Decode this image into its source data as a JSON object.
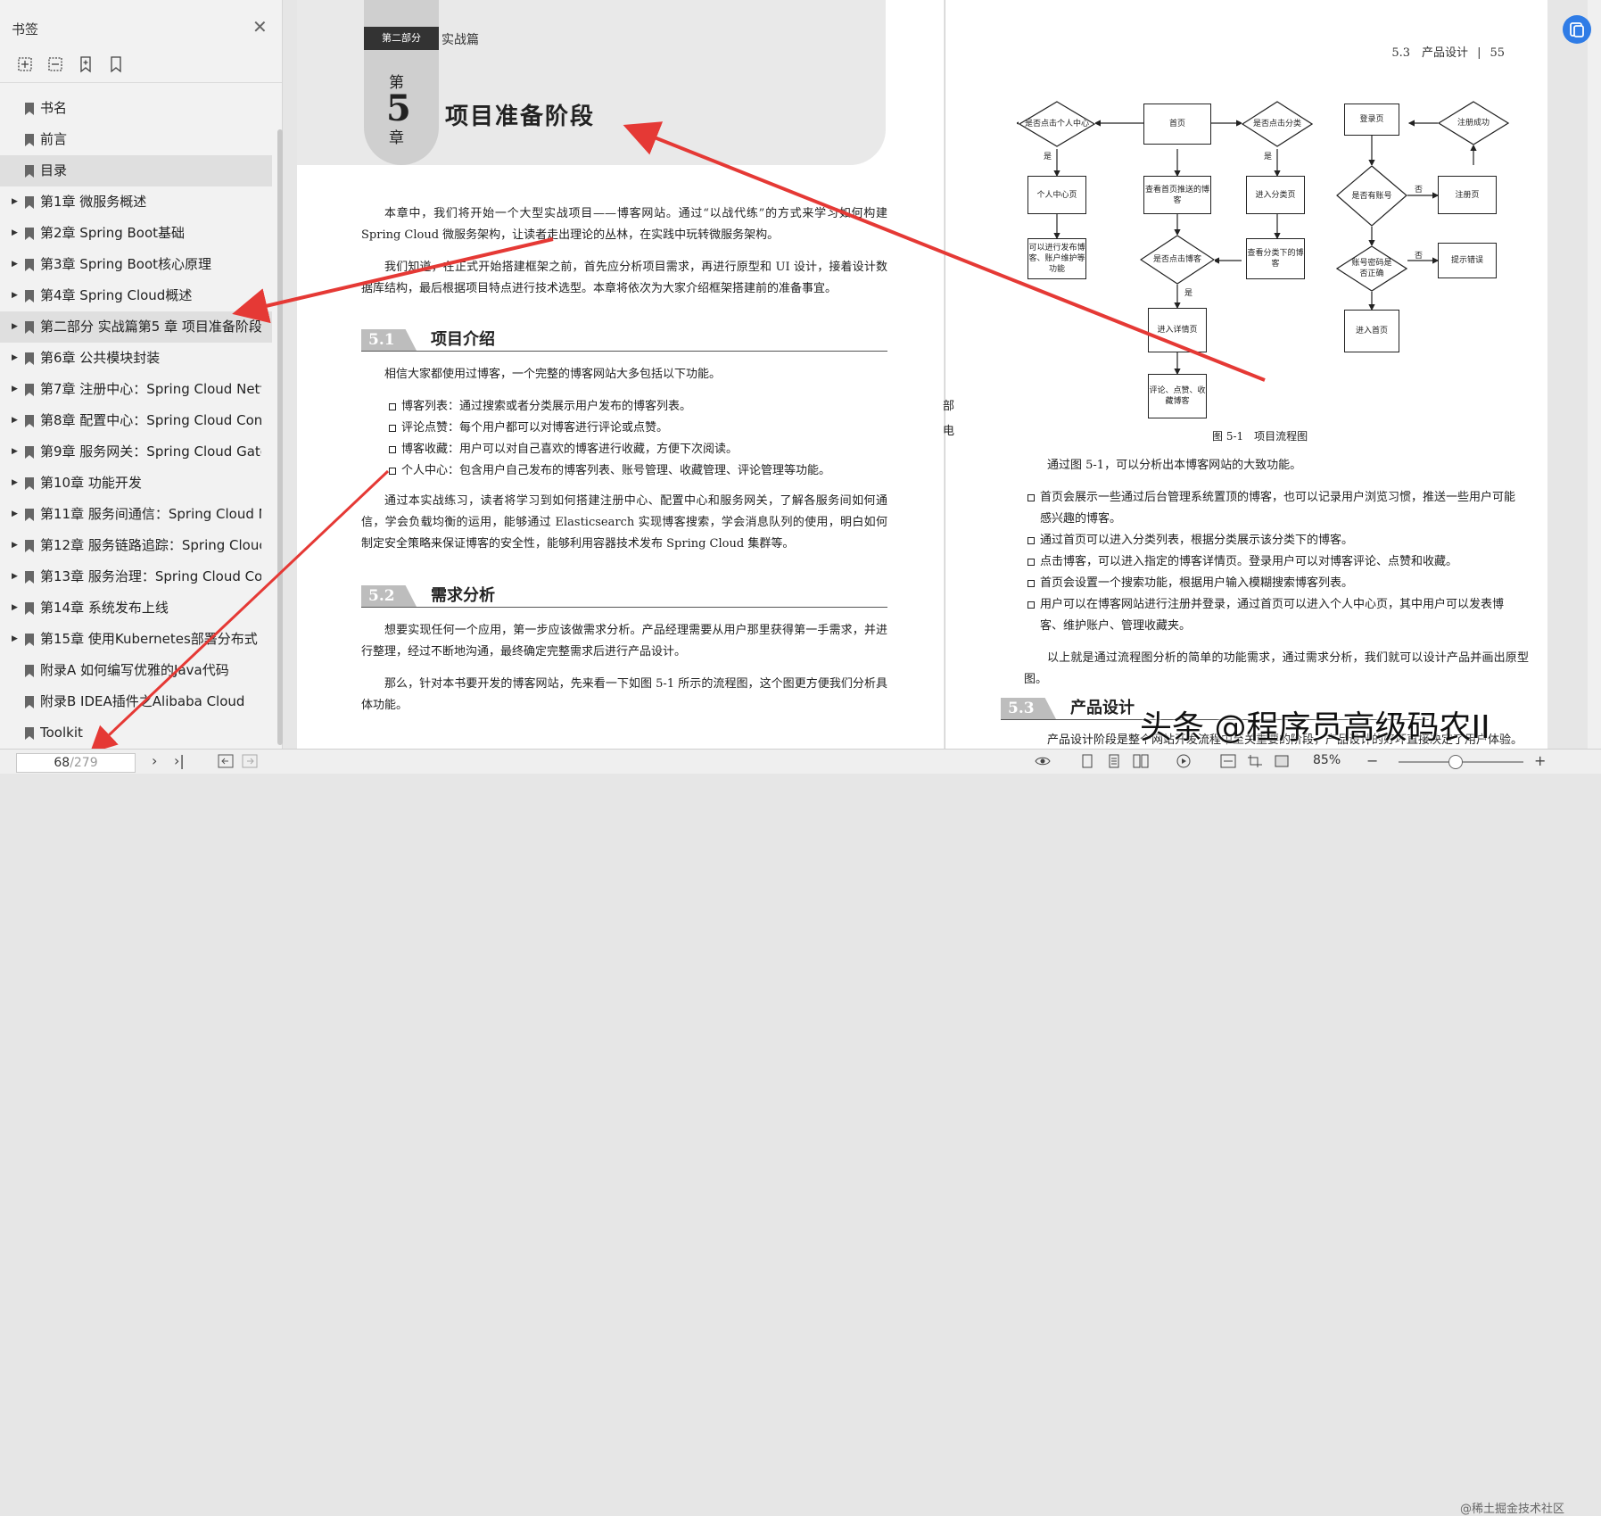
{
  "sidebar": {
    "title": "书签",
    "close_icon": "close-icon",
    "tools": [
      "expand-all-icon",
      "collapse-all-icon",
      "add-bookmark-icon",
      "bookmark-icon"
    ],
    "items": [
      {
        "label": "书名",
        "expandable": false
      },
      {
        "label": "前言",
        "expandable": false
      },
      {
        "label": "目录",
        "expandable": false
      },
      {
        "label": "第1章 微服务概述",
        "expandable": true
      },
      {
        "label": "第2章 Spring Boot基础",
        "expandable": true
      },
      {
        "label": "第3章 Spring Boot核心原理",
        "expandable": true
      },
      {
        "label": "第4章 Spring Cloud概述",
        "expandable": true
      },
      {
        "label": "第二部分 实战篇第5 章 项目准备阶段",
        "expandable": true
      },
      {
        "label": "第6章 公共模块封装",
        "expandable": true
      },
      {
        "label": "第7章 注册中心：Spring Cloud Netf",
        "expandable": true
      },
      {
        "label": "第8章 配置中心：Spring Cloud Con",
        "expandable": true
      },
      {
        "label": "第9章 服务网关：Spring Cloud Gate",
        "expandable": true
      },
      {
        "label": "第10章 功能开发",
        "expandable": true
      },
      {
        "label": "第11章 服务间通信：Spring Cloud N",
        "expandable": true
      },
      {
        "label": "第12章 服务链路追踪：Spring Clouc",
        "expandable": true
      },
      {
        "label": "第13章 服务治理：Spring Cloud Co",
        "expandable": true
      },
      {
        "label": "第14章 系统发布上线",
        "expandable": true
      },
      {
        "label": "第15章 使用Kubernetes部署分布式",
        "expandable": true
      },
      {
        "label": "附录A 如何编写优雅的Java代码",
        "expandable": false
      },
      {
        "label": "附录B IDEA插件之Alibaba Cloud",
        "expandable": false
      },
      {
        "label": "Toolkit",
        "expandable": false
      }
    ]
  },
  "bottom": {
    "page_current": "68",
    "page_total": "/279",
    "zoom": "85%"
  },
  "left_page": {
    "part_label": "第二部分",
    "part_name": "实战篇",
    "chapter_di": "第",
    "chapter_num": "5",
    "chapter_zhang": "章",
    "chapter_title": "项目准备阶段",
    "intro1": "本章中，我们将开始一个大型实战项目——博客网站。通过“以战代练”的方式来学习如何构建Spring Cloud 微服务架构，让读者走出理论的丛林，在实践中玩转微服务架构。",
    "intro2": "我们知道，在正式开始搭建框架之前，首先应分析项目需求，再进行原型和 UI 设计，接着设计数据库结构，最后根据项目特点进行技术选型。本章将依次为大家介绍框架搭建前的准备事宜。",
    "sec1_num": "5.1",
    "sec1_title": "项目介绍",
    "sec1_p1": "相信大家都使用过博客，一个完整的博客网站大多包括以下功能。",
    "sec1_bullets": [
      "博客列表：通过搜索或者分类展示用户发布的博客列表。",
      "评论点赞：每个用户都可以对博客进行评论或点赞。",
      "博客收藏：用户可以对自己喜欢的博客进行收藏，方便下次阅读。",
      "个人中心：包含用户自己发布的博客列表、账号管理、收藏管理、评论管理等功能。"
    ],
    "sec1_p2": "通过本实战练习，读者将学习到如何搭建注册中心、配置中心和服务网关，了解各服务间如何通信，学会负载均衡的运用，能够通过 Elasticsearch 实现博客搜索，学会消息队列的使用，明白如何制定安全策略来保证博客的安全性，能够利用容器技术发布 Spring Cloud 集群等。",
    "sec2_num": "5.2",
    "sec2_title": "需求分析",
    "sec2_p1": "想要实现任何一个应用，第一步应该做需求分析。产品经理需要从用户那里获得第一手需求，并进行整理，经过不断地沟通，最终确定完整需求后进行产品设计。",
    "sec2_p2": "那么，针对本书要开发的博客网站，先来看一下如图 5-1 所示的流程图，这个图更方便我们分析具体功能。"
  },
  "right_page": {
    "header_section": "5.3　产品设计",
    "header_sep": "|",
    "header_page": "55",
    "edge_chars": [
      "部",
      "电"
    ],
    "flow_nodes": {
      "personal_center_q": "是否点击个人中心",
      "home": "首页",
      "category_q": "是否点击分类",
      "login": "登录页",
      "register_success": "注册成功",
      "yes1": "是",
      "yes2": "是",
      "personal_page": "个人中心页",
      "view_home_blogs": "查看首页推送的博客",
      "enter_category": "进入分类页",
      "has_account_q": "是否有账号",
      "no1": "否",
      "register_page": "注册页",
      "personal_actions": "可以进行发布博客、账户维护等功能",
      "blog_click_q": "是否点击博客",
      "view_category_blogs": "查看分类下的博客",
      "password_q": "账号密码是否正确",
      "no2": "否",
      "error_tip": "提示错误",
      "yes3": "是",
      "enter_detail": "进入详情页",
      "enter_home": "进入首页",
      "comment_like": "评论、点赞、收藏博客"
    },
    "fig_caption": "图 5-1　项目流程图",
    "p1": "通过图 5-1，可以分析出本博客网站的大致功能。",
    "bullets": [
      "首页会展示一些通过后台管理系统置顶的博客，也可以记录用户浏览习惯，推送一些用户可能感兴趣的博客。",
      "通过首页可以进入分类列表，根据分类展示该分类下的博客。",
      "点击博客，可以进入指定的博客详情页。登录用户可以对博客评论、点赞和收藏。",
      "首页会设置一个搜索功能，根据用户输入模糊搜索博客列表。",
      "用户可以在博客网站进行注册并登录，通过首页可以进入个人中心页，其中用户可以发表博客、维护账户、管理收藏夹。"
    ],
    "p2": "以上就是通过流程图分析的简单的功能需求，通过需求分析，我们就可以设计产品并画出原型图。",
    "sec_num": "5.3",
    "sec_title": "产品设计",
    "p3": "产品设计阶段是整个网站开发流程中至关重要的阶段，产品设计的好坏直接决定了用户体验。"
  },
  "watermark": "头条 @程序员高级码农II",
  "watermark2": "@稀土掘金技术社区",
  "colors": {
    "arrow": "#e53935",
    "accent": "#2f7ce6"
  }
}
